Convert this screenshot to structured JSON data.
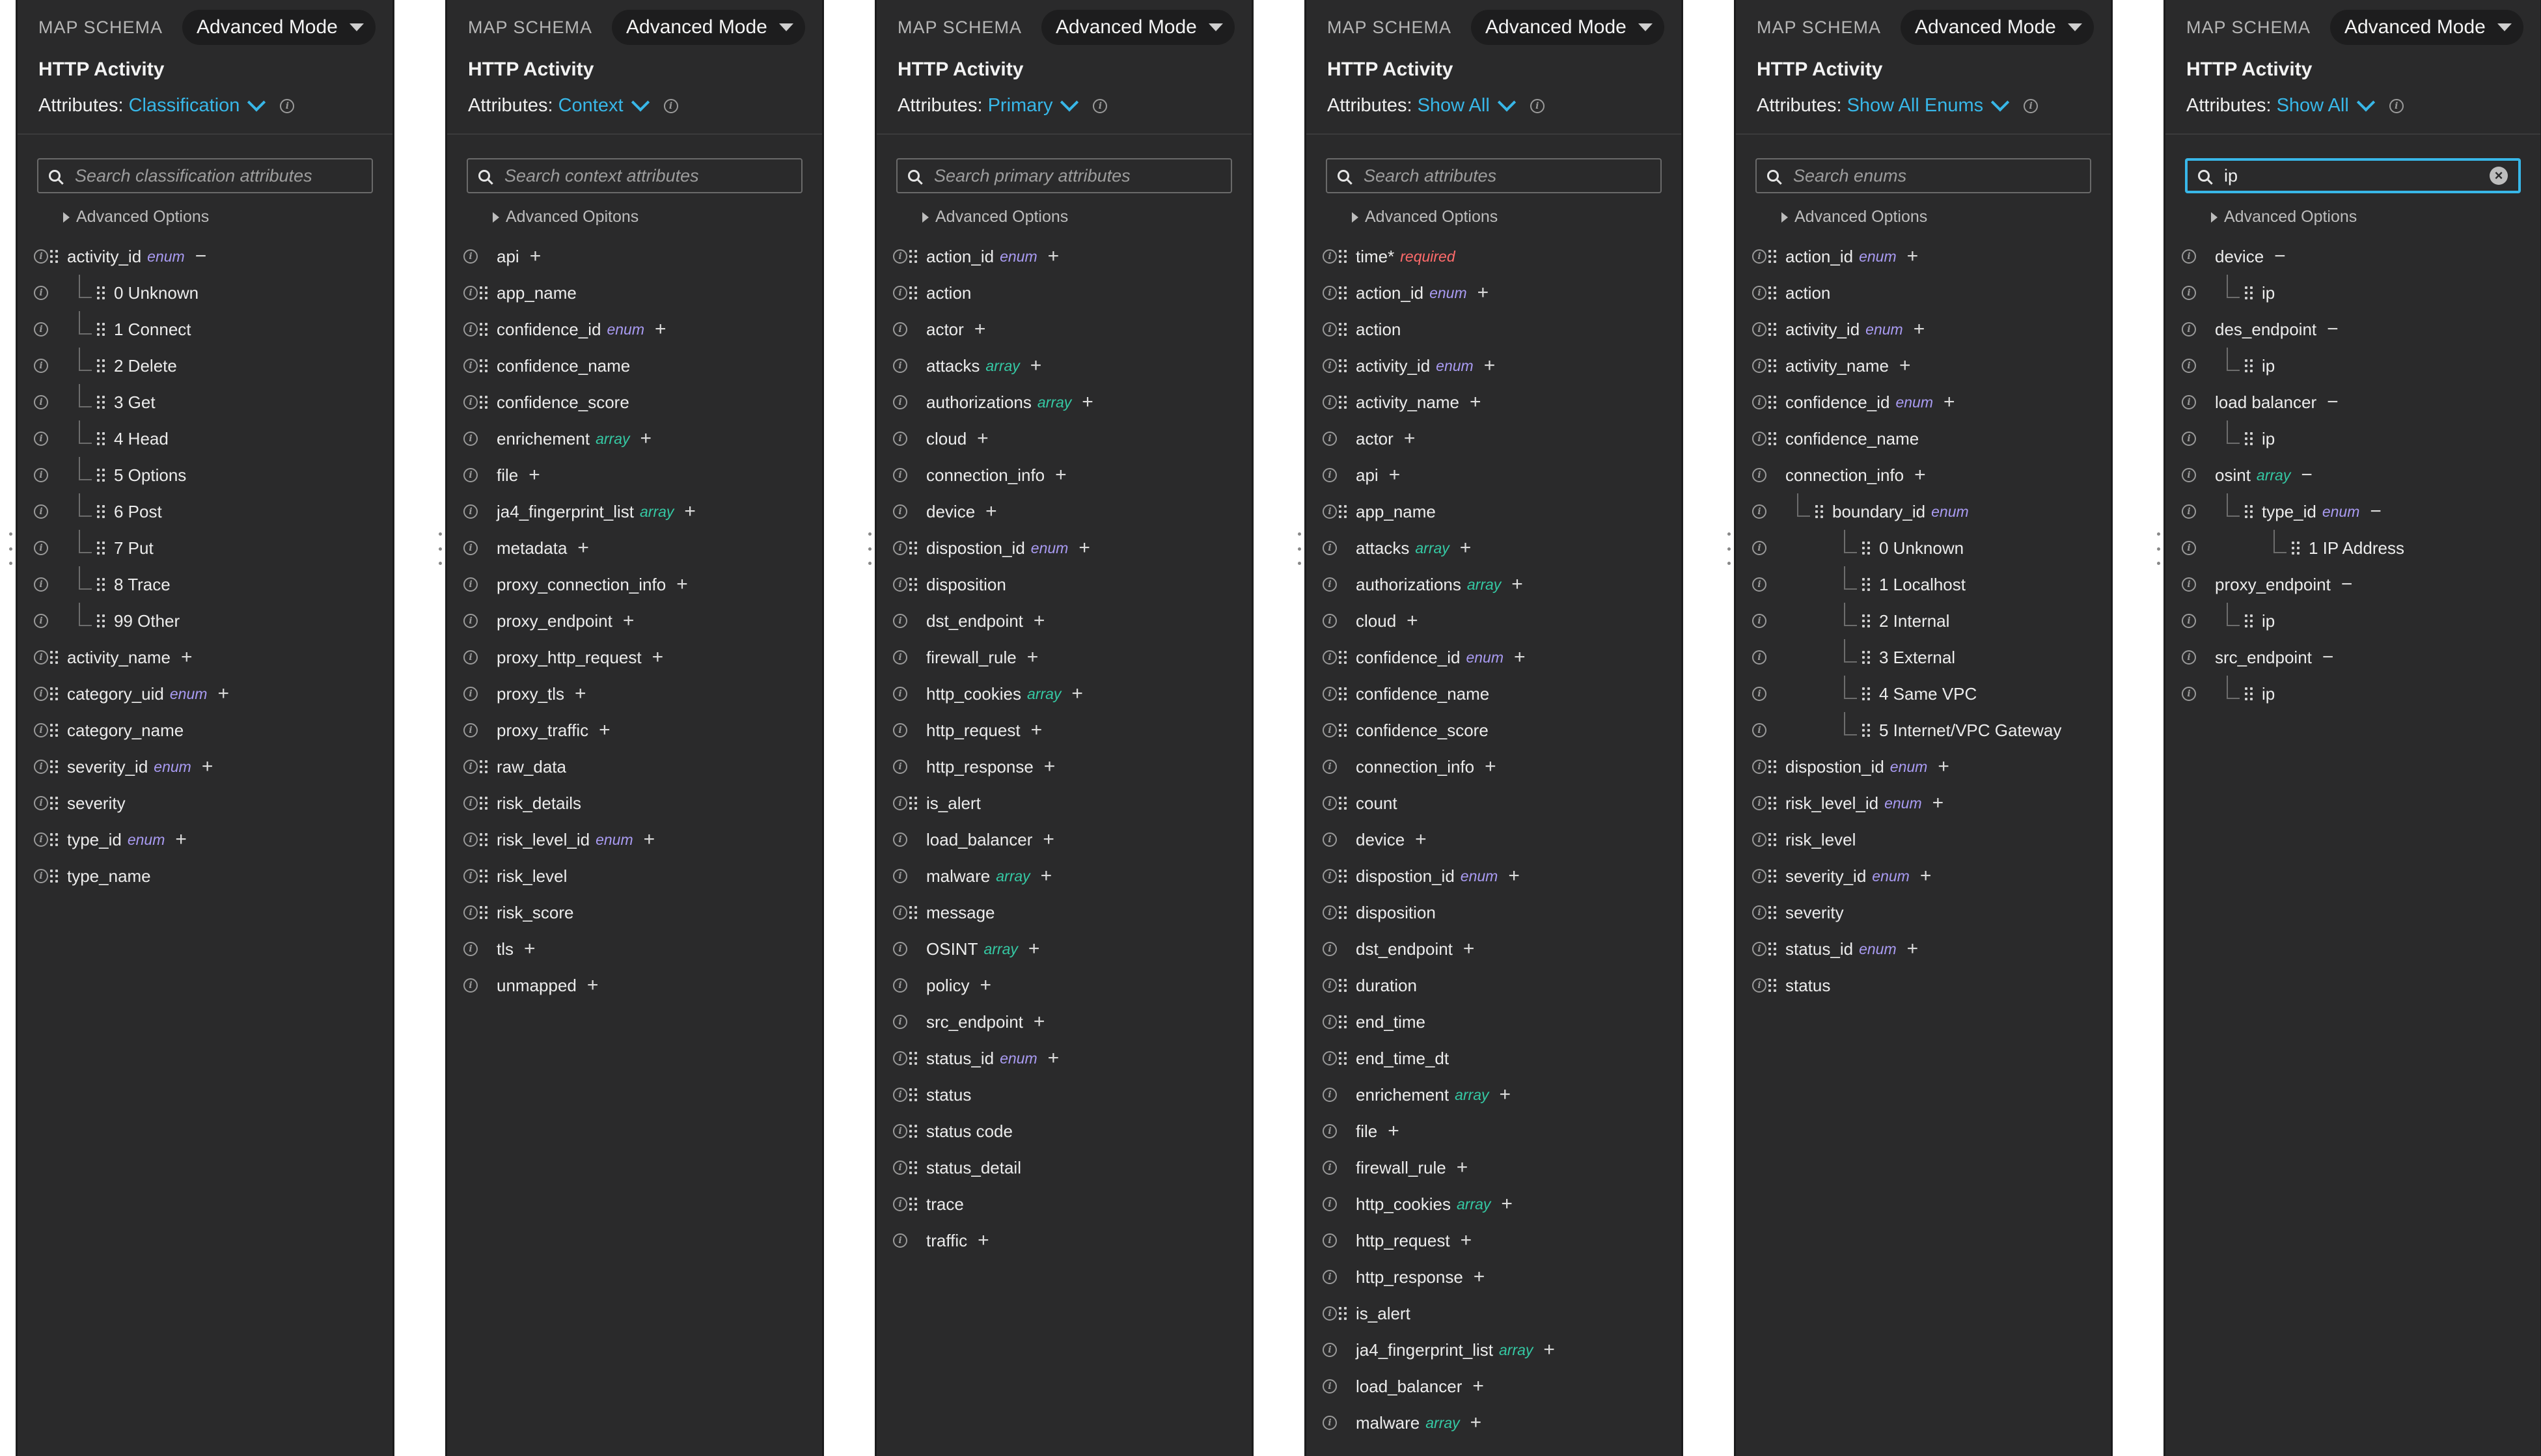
{
  "panels": [
    {
      "header": {
        "map_schema": "MAP SCHEMA",
        "mode": "Advanced Mode",
        "title": "HTTP Activity",
        "attributes_label": "Attributes:",
        "attributes_value": "Classification"
      },
      "search": {
        "placeholder": "Search classification attributes",
        "value": ""
      },
      "advanced_options": "Advanced Options",
      "rows": [
        {
          "label": "activity_id",
          "tag": "enum",
          "op": "−",
          "depth": 0,
          "grip": true
        },
        {
          "label": "0 Unknown",
          "depth": 1,
          "grip": true
        },
        {
          "label": "1 Connect",
          "depth": 1,
          "grip": true
        },
        {
          "label": "2 Delete",
          "depth": 1,
          "grip": true
        },
        {
          "label": "3 Get",
          "depth": 1,
          "grip": true
        },
        {
          "label": "4 Head",
          "depth": 1,
          "grip": true
        },
        {
          "label": "5 Options",
          "depth": 1,
          "grip": true
        },
        {
          "label": "6 Post",
          "depth": 1,
          "grip": true
        },
        {
          "label": "7 Put",
          "depth": 1,
          "grip": true
        },
        {
          "label": "8 Trace",
          "depth": 1,
          "grip": true
        },
        {
          "label": "99 Other",
          "depth": 1,
          "grip": true
        },
        {
          "label": "activity_name",
          "op": "+",
          "depth": 0,
          "grip": true
        },
        {
          "label": "category_uid",
          "tag": "enum",
          "op": "+",
          "depth": 0,
          "grip": true
        },
        {
          "label": "category_name",
          "depth": 0,
          "grip": true
        },
        {
          "label": "severity_id",
          "tag": "enum",
          "op": "+",
          "depth": 0,
          "grip": true
        },
        {
          "label": "severity",
          "depth": 0,
          "grip": true
        },
        {
          "label": "type_id",
          "tag": "enum",
          "op": "+",
          "depth": 0,
          "grip": true
        },
        {
          "label": "type_name",
          "depth": 0,
          "grip": true
        }
      ]
    },
    {
      "header": {
        "map_schema": "MAP SCHEMA",
        "mode": "Advanced Mode",
        "title": "HTTP Activity",
        "attributes_label": "Attributes:",
        "attributes_value": "Context"
      },
      "search": {
        "placeholder": "Search context attributes",
        "value": ""
      },
      "advanced_options": "Advanced Opitons",
      "rows": [
        {
          "label": "api",
          "op": "+",
          "depth": 0,
          "grip": false
        },
        {
          "label": "app_name",
          "depth": 0,
          "grip": true
        },
        {
          "label": "confidence_id",
          "tag": "enum",
          "op": "+",
          "depth": 0,
          "grip": true
        },
        {
          "label": "confidence_name",
          "depth": 0,
          "grip": true
        },
        {
          "label": "confidence_score",
          "depth": 0,
          "grip": true
        },
        {
          "label": "enrichement",
          "tag": "array",
          "op": "+",
          "depth": 0,
          "grip": false
        },
        {
          "label": "file",
          "op": "+",
          "depth": 0,
          "grip": false
        },
        {
          "label": "ja4_fingerprint_list",
          "tag": "array",
          "op": "+",
          "depth": 0,
          "grip": false
        },
        {
          "label": "metadata",
          "op": "+",
          "depth": 0,
          "grip": false
        },
        {
          "label": "proxy_connection_info",
          "op": "+",
          "depth": 0,
          "grip": false
        },
        {
          "label": "proxy_endpoint",
          "op": "+",
          "depth": 0,
          "grip": false
        },
        {
          "label": "proxy_http_request",
          "op": "+",
          "depth": 0,
          "grip": false
        },
        {
          "label": "proxy_tls",
          "op": "+",
          "depth": 0,
          "grip": false
        },
        {
          "label": "proxy_traffic",
          "op": "+",
          "depth": 0,
          "grip": false
        },
        {
          "label": "raw_data",
          "depth": 0,
          "grip": true
        },
        {
          "label": "risk_details",
          "depth": 0,
          "grip": true
        },
        {
          "label": "risk_level_id",
          "tag": "enum",
          "op": "+",
          "depth": 0,
          "grip": true
        },
        {
          "label": "risk_level",
          "depth": 0,
          "grip": true
        },
        {
          "label": "risk_score",
          "depth": 0,
          "grip": true
        },
        {
          "label": "tls",
          "op": "+",
          "depth": 0,
          "grip": false
        },
        {
          "label": "unmapped",
          "op": "+",
          "depth": 0,
          "grip": false
        }
      ]
    },
    {
      "header": {
        "map_schema": "MAP SCHEMA",
        "mode": "Advanced Mode",
        "title": "HTTP Activity",
        "attributes_label": "Attributes:",
        "attributes_value": "Primary"
      },
      "search": {
        "placeholder": "Search primary attributes",
        "value": ""
      },
      "advanced_options": "Advanced Options",
      "rows": [
        {
          "label": "action_id",
          "tag": "enum",
          "op": "+",
          "depth": 0,
          "grip": true
        },
        {
          "label": "action",
          "depth": 0,
          "grip": true
        },
        {
          "label": "actor",
          "op": "+",
          "depth": 0,
          "grip": false
        },
        {
          "label": "attacks",
          "tag": "array",
          "op": "+",
          "depth": 0,
          "grip": false
        },
        {
          "label": "authorizations",
          "tag": "array",
          "op": "+",
          "depth": 0,
          "grip": false
        },
        {
          "label": "cloud",
          "op": "+",
          "depth": 0,
          "grip": false
        },
        {
          "label": "connection_info",
          "op": "+",
          "depth": 0,
          "grip": false
        },
        {
          "label": "device",
          "op": "+",
          "depth": 0,
          "grip": false
        },
        {
          "label": "dispostion_id",
          "tag": "enum",
          "op": "+",
          "depth": 0,
          "grip": true
        },
        {
          "label": "disposition",
          "depth": 0,
          "grip": true
        },
        {
          "label": "dst_endpoint",
          "op": "+",
          "depth": 0,
          "grip": false
        },
        {
          "label": "firewall_rule",
          "op": "+",
          "depth": 0,
          "grip": false
        },
        {
          "label": "http_cookies",
          "tag": "array",
          "op": "+",
          "depth": 0,
          "grip": false
        },
        {
          "label": "http_request",
          "op": "+",
          "depth": 0,
          "grip": false
        },
        {
          "label": "http_response",
          "op": "+",
          "depth": 0,
          "grip": false
        },
        {
          "label": "is_alert",
          "depth": 0,
          "grip": true
        },
        {
          "label": "load_balancer",
          "op": "+",
          "depth": 0,
          "grip": false
        },
        {
          "label": "malware",
          "tag": "array",
          "op": "+",
          "depth": 0,
          "grip": false
        },
        {
          "label": "message",
          "depth": 0,
          "grip": true
        },
        {
          "label": "OSINT",
          "tag": "array",
          "op": "+",
          "depth": 0,
          "grip": false
        },
        {
          "label": "policy",
          "op": "+",
          "depth": 0,
          "grip": false
        },
        {
          "label": "src_endpoint",
          "op": "+",
          "depth": 0,
          "grip": false
        },
        {
          "label": "status_id",
          "tag": "enum",
          "op": "+",
          "depth": 0,
          "grip": true
        },
        {
          "label": "status",
          "depth": 0,
          "grip": true
        },
        {
          "label": "status code",
          "depth": 0,
          "grip": true
        },
        {
          "label": "status_detail",
          "depth": 0,
          "grip": true
        },
        {
          "label": "trace",
          "depth": 0,
          "grip": true
        },
        {
          "label": "traffic",
          "op": "+",
          "depth": 0,
          "grip": false
        }
      ]
    },
    {
      "header": {
        "map_schema": "MAP SCHEMA",
        "mode": "Advanced Mode",
        "title": "HTTP Activity",
        "attributes_label": "Attributes:",
        "attributes_value": "Show All"
      },
      "search": {
        "placeholder": "Search attributes",
        "value": ""
      },
      "advanced_options": "Advanced Options",
      "rows": [
        {
          "label": "time*",
          "tag": "required",
          "depth": 0,
          "grip": true
        },
        {
          "label": "action_id",
          "tag": "enum",
          "op": "+",
          "depth": 0,
          "grip": true
        },
        {
          "label": "action",
          "depth": 0,
          "grip": true
        },
        {
          "label": "activity_id",
          "tag": "enum",
          "op": "+",
          "depth": 0,
          "grip": true
        },
        {
          "label": "activity_name",
          "op": "+",
          "depth": 0,
          "grip": true
        },
        {
          "label": "actor",
          "op": "+",
          "depth": 0,
          "grip": false
        },
        {
          "label": "api",
          "op": "+",
          "depth": 0,
          "grip": false
        },
        {
          "label": "app_name",
          "depth": 0,
          "grip": true
        },
        {
          "label": "attacks",
          "tag": "array",
          "op": "+",
          "depth": 0,
          "grip": false
        },
        {
          "label": "authorizations",
          "tag": "array",
          "op": "+",
          "depth": 0,
          "grip": false
        },
        {
          "label": "cloud",
          "op": "+",
          "depth": 0,
          "grip": false
        },
        {
          "label": "confidence_id",
          "tag": "enum",
          "op": "+",
          "depth": 0,
          "grip": true
        },
        {
          "label": "confidence_name",
          "depth": 0,
          "grip": true
        },
        {
          "label": "confidence_score",
          "depth": 0,
          "grip": true
        },
        {
          "label": "connection_info",
          "op": "+",
          "depth": 0,
          "grip": false
        },
        {
          "label": "count",
          "depth": 0,
          "grip": true
        },
        {
          "label": "device",
          "op": "+",
          "depth": 0,
          "grip": false
        },
        {
          "label": "dispostion_id",
          "tag": "enum",
          "op": "+",
          "depth": 0,
          "grip": true
        },
        {
          "label": "disposition",
          "depth": 0,
          "grip": true
        },
        {
          "label": "dst_endpoint",
          "op": "+",
          "depth": 0,
          "grip": false
        },
        {
          "label": "duration",
          "depth": 0,
          "grip": true
        },
        {
          "label": "end_time",
          "depth": 0,
          "grip": true
        },
        {
          "label": "end_time_dt",
          "depth": 0,
          "grip": true
        },
        {
          "label": "enrichement",
          "tag": "array",
          "op": "+",
          "depth": 0,
          "grip": false
        },
        {
          "label": "file",
          "op": "+",
          "depth": 0,
          "grip": false
        },
        {
          "label": "firewall_rule",
          "op": "+",
          "depth": 0,
          "grip": false
        },
        {
          "label": "http_cookies",
          "tag": "array",
          "op": "+",
          "depth": 0,
          "grip": false
        },
        {
          "label": "http_request",
          "op": "+",
          "depth": 0,
          "grip": false
        },
        {
          "label": "http_response",
          "op": "+",
          "depth": 0,
          "grip": false
        },
        {
          "label": "is_alert",
          "depth": 0,
          "grip": true
        },
        {
          "label": "ja4_fingerprint_list",
          "tag": "array",
          "op": "+",
          "depth": 0,
          "grip": false
        },
        {
          "label": "load_balancer",
          "op": "+",
          "depth": 0,
          "grip": false
        },
        {
          "label": "malware",
          "tag": "array",
          "op": "+",
          "depth": 0,
          "grip": false
        }
      ]
    },
    {
      "header": {
        "map_schema": "MAP SCHEMA",
        "mode": "Advanced Mode",
        "title": "HTTP Activity",
        "attributes_label": "Attributes:",
        "attributes_value": "Show All Enums"
      },
      "search": {
        "placeholder": "Search enums",
        "value": ""
      },
      "advanced_options": "Advanced Options",
      "rows": [
        {
          "label": "action_id",
          "tag": "enum",
          "op": "+",
          "depth": 0,
          "grip": true
        },
        {
          "label": "action",
          "depth": 0,
          "grip": true
        },
        {
          "label": "activity_id",
          "tag": "enum",
          "op": "+",
          "depth": 0,
          "grip": true
        },
        {
          "label": "activity_name",
          "op": "+",
          "depth": 0,
          "grip": true
        },
        {
          "label": "confidence_id",
          "tag": "enum",
          "op": "+",
          "depth": 0,
          "grip": true
        },
        {
          "label": "confidence_name",
          "depth": 0,
          "grip": true
        },
        {
          "label": "connection_info",
          "op": "+",
          "depth": 0,
          "grip": false
        },
        {
          "label": "boundary_id",
          "tag": "enum",
          "depth": 1,
          "grip": true
        },
        {
          "label": "0 Unknown",
          "depth": 2,
          "grip": true
        },
        {
          "label": "1 Localhost",
          "depth": 2,
          "grip": true
        },
        {
          "label": "2 Internal",
          "depth": 2,
          "grip": true
        },
        {
          "label": "3 External",
          "depth": 2,
          "grip": true
        },
        {
          "label": "4 Same VPC",
          "depth": 2,
          "grip": true
        },
        {
          "label": "5 Internet/VPC Gateway",
          "depth": 2,
          "grip": true
        },
        {
          "label": "dispostion_id",
          "tag": "enum",
          "op": "+",
          "depth": 0,
          "grip": true
        },
        {
          "label": "risk_level_id",
          "tag": "enum",
          "op": "+",
          "depth": 0,
          "grip": true
        },
        {
          "label": "risk_level",
          "depth": 0,
          "grip": true
        },
        {
          "label": "severity_id",
          "tag": "enum",
          "op": "+",
          "depth": 0,
          "grip": true
        },
        {
          "label": "severity",
          "depth": 0,
          "grip": true
        },
        {
          "label": "status_id",
          "tag": "enum",
          "op": "+",
          "depth": 0,
          "grip": true
        },
        {
          "label": "status",
          "depth": 0,
          "grip": true
        }
      ]
    },
    {
      "header": {
        "map_schema": "MAP SCHEMA",
        "mode": "Advanced Mode",
        "title": "HTTP Activity",
        "attributes_label": "Attributes:",
        "attributes_value": "Show All"
      },
      "search": {
        "placeholder": "",
        "value": "ip"
      },
      "advanced_options": "Advanced Options",
      "rows": [
        {
          "label": "device",
          "op": "−",
          "depth": 0,
          "grip": false
        },
        {
          "label": "ip",
          "depth": 1,
          "grip": true
        },
        {
          "label": "des_endpoint",
          "op": "−",
          "depth": 0,
          "grip": false
        },
        {
          "label": "ip",
          "depth": 1,
          "grip": true
        },
        {
          "label": "load balancer",
          "op": "−",
          "depth": 0,
          "grip": false
        },
        {
          "label": "ip",
          "depth": 1,
          "grip": true
        },
        {
          "label": "osint",
          "tag": "array",
          "op": "−",
          "depth": 0,
          "grip": false
        },
        {
          "label": "type_id",
          "tag": "enum",
          "op": "−",
          "depth": 1,
          "grip": true
        },
        {
          "label": "1 IP Address",
          "depth": 2,
          "grip": true
        },
        {
          "label": "proxy_endpoint",
          "op": "−",
          "depth": 0,
          "grip": false
        },
        {
          "label": "ip",
          "depth": 1,
          "grip": true
        },
        {
          "label": "src_endpoint",
          "op": "−",
          "depth": 0,
          "grip": false
        },
        {
          "label": "ip",
          "depth": 1,
          "grip": true
        }
      ]
    }
  ]
}
